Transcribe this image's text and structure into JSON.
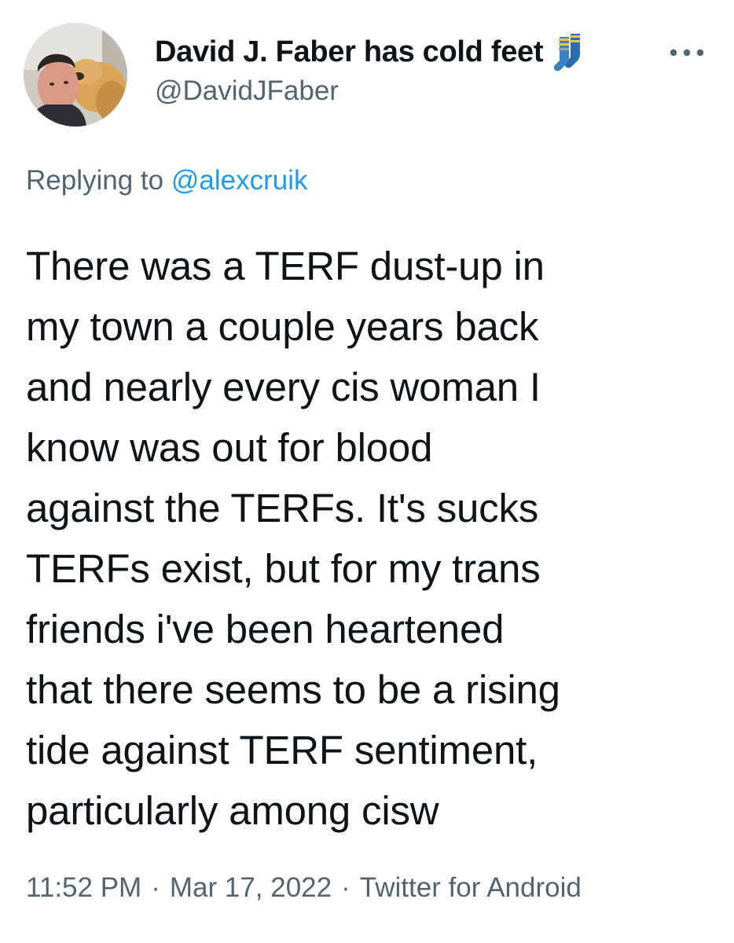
{
  "author": {
    "display_name": "David J. Faber has cold feet",
    "handle": "@DavidJFaber",
    "name_emoji": "socks-emoji"
  },
  "reply": {
    "prefix": "Replying to",
    "mention": "@alexcruik"
  },
  "body": {
    "lines": [
      "There was a TERF dust-up in",
      "my town a couple years back",
      "and nearly every cis woman I",
      "know was out for blood",
      "against the TERFs. It's sucks",
      "TERFs exist, but for my trans",
      "friends i've been heartened",
      "that there seems to be a rising",
      "tide against TERF sentiment,",
      "particularly among cisw"
    ]
  },
  "meta": {
    "time": "11:52 PM",
    "date": "Mar 17, 2022",
    "source": "Twitter for Android",
    "separator": "·"
  },
  "colors": {
    "text_primary": "#0f1419",
    "text_secondary": "#536471",
    "link": "#1d9bf0",
    "background": "#ffffff"
  },
  "icons": {
    "more": "more-options-icon",
    "avatar": "profile-avatar"
  }
}
